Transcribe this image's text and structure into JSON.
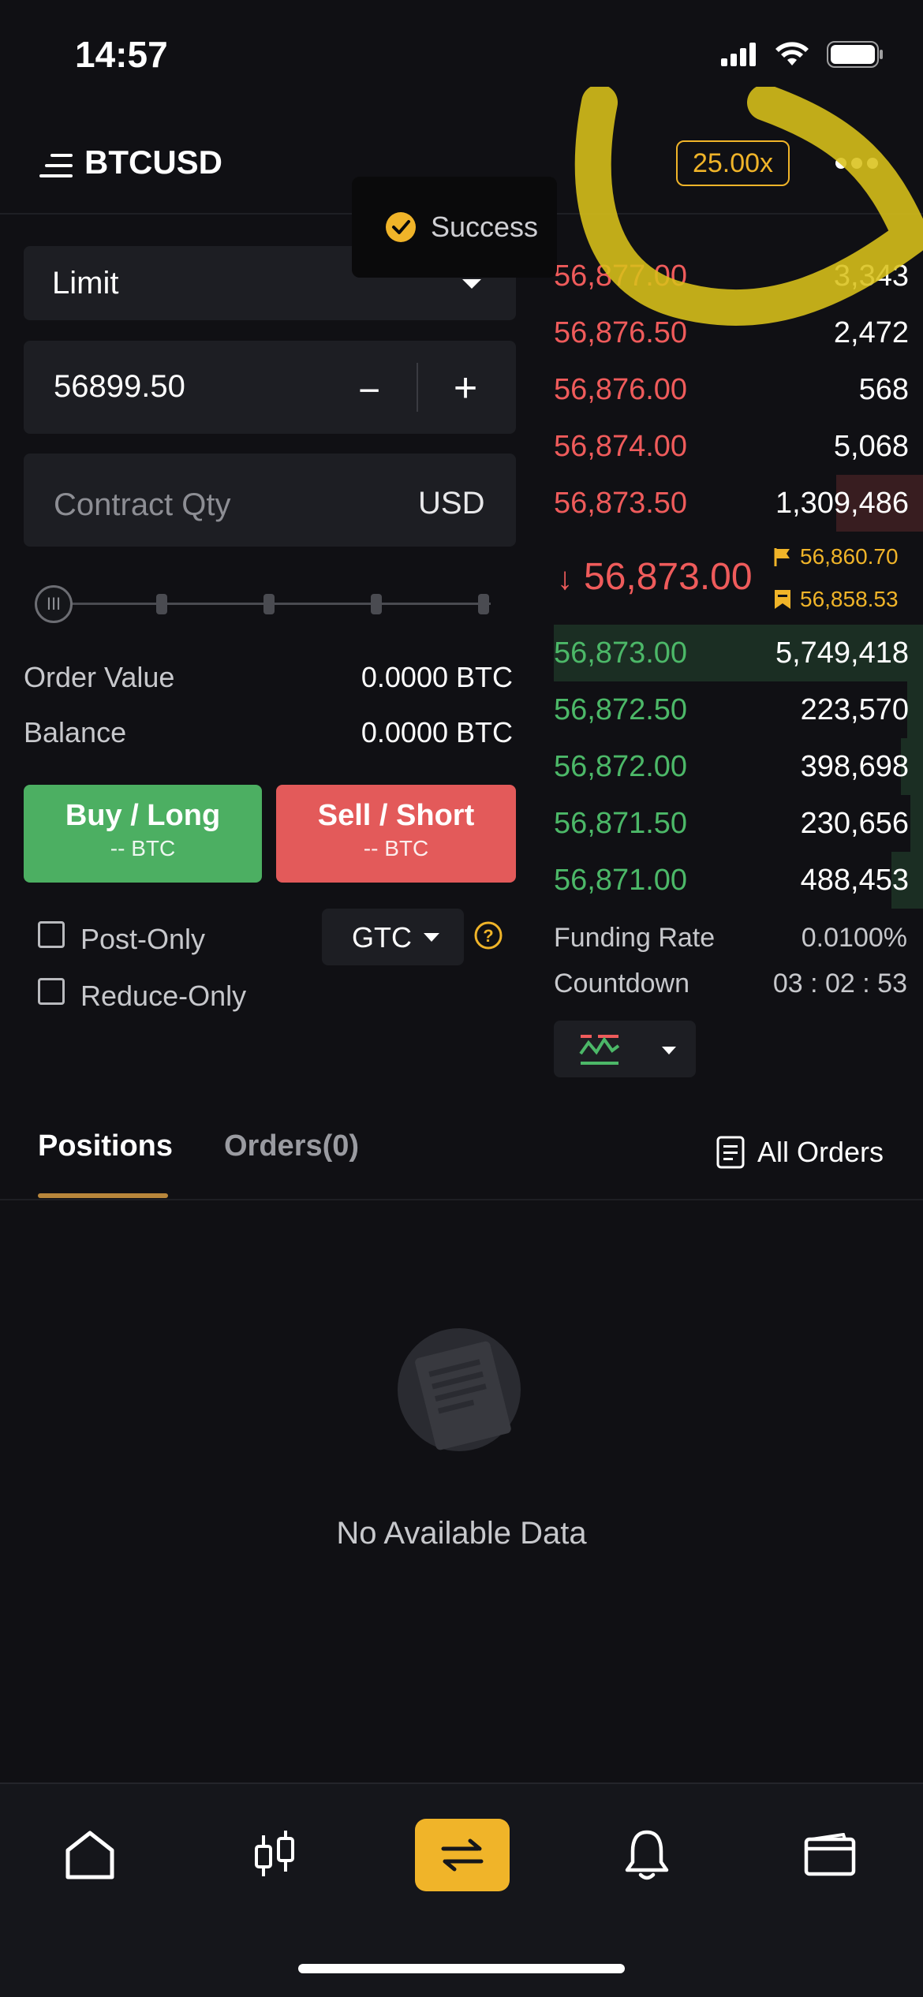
{
  "status_bar": {
    "time": "14:57"
  },
  "header": {
    "symbol": "BTCUSD",
    "leverage": "25.00x"
  },
  "toast": {
    "text": "Success"
  },
  "order_form": {
    "order_type": "Limit",
    "price_value": "56899.50",
    "minus_label": "−",
    "plus_label": "+",
    "qty_placeholder": "Contract Qty",
    "qty_unit": "USD",
    "slider_percent": 0,
    "slider_knob_label": "III",
    "order_value_label": "Order Value",
    "order_value": "0.0000 BTC",
    "balance_label": "Balance",
    "balance_value": "0.0000 BTC",
    "buy_label": "Buy / Long",
    "buy_sub": "-- BTC",
    "sell_label": "Sell / Short",
    "sell_sub": "-- BTC",
    "post_only_label": "Post-Only",
    "reduce_only_label": "Reduce-Only",
    "time_in_force": "GTC"
  },
  "order_book": {
    "asks": [
      {
        "price": "56,877.00",
        "qty": "3,343"
      },
      {
        "price": "56,876.50",
        "qty": "2,472"
      },
      {
        "price": "56,876.00",
        "qty": "568"
      },
      {
        "price": "56,874.00",
        "qty": "5,068"
      },
      {
        "price": "56,873.50",
        "qty": "1,309,486"
      }
    ],
    "last_price": "56,873.00",
    "mark_price": "56,860.70",
    "index_price": "56,858.53",
    "bids": [
      {
        "price": "56,873.00",
        "qty": "5,749,418"
      },
      {
        "price": "56,872.50",
        "qty": "223,570"
      },
      {
        "price": "56,872.00",
        "qty": "398,698"
      },
      {
        "price": "56,871.50",
        "qty": "230,656"
      },
      {
        "price": "56,871.00",
        "qty": "488,453"
      }
    ],
    "funding_rate_label": "Funding Rate",
    "funding_rate": "0.0100%",
    "countdown_label": "Countdown",
    "countdown": "03 : 02 : 53"
  },
  "tabs": {
    "positions": "Positions",
    "orders": "Orders(0)",
    "all_orders": "All Orders"
  },
  "empty_state": {
    "text": "No Available Data"
  },
  "colors": {
    "accent": "#f0b429",
    "buy": "#4caf62",
    "sell": "#e35a5a",
    "ask_text": "#ef5b5b",
    "bid_text": "#4cb868",
    "background": "#101014"
  },
  "bottom_nav": {
    "items": [
      "home-icon",
      "chart-candles-icon",
      "trade-swap-icon",
      "bell-icon",
      "wallet-icon"
    ],
    "active": "trade-swap-icon"
  }
}
